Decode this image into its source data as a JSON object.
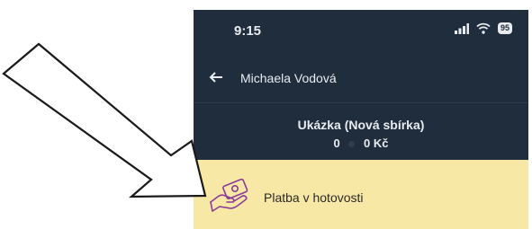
{
  "status_bar": {
    "time": "9:15",
    "battery": "95",
    "signal_icon": "signal-icon",
    "wifi_icon": "wifi-icon"
  },
  "header": {
    "back_icon": "back-arrow-icon",
    "contact_name": "Michaela Vodová"
  },
  "collection": {
    "title": "Ukázka (Nová sbírka)",
    "count": "0",
    "amount": "0 Kč"
  },
  "payment_option": {
    "icon": "cash-hand-icon",
    "label": "Platba v hotovosti"
  },
  "annotation": {
    "icon": "pointer-arrow-icon"
  },
  "colors": {
    "app_bg": "#1f2d3d",
    "highlight": "#f8e8a6",
    "icon_purple": "#8a3b9a"
  }
}
